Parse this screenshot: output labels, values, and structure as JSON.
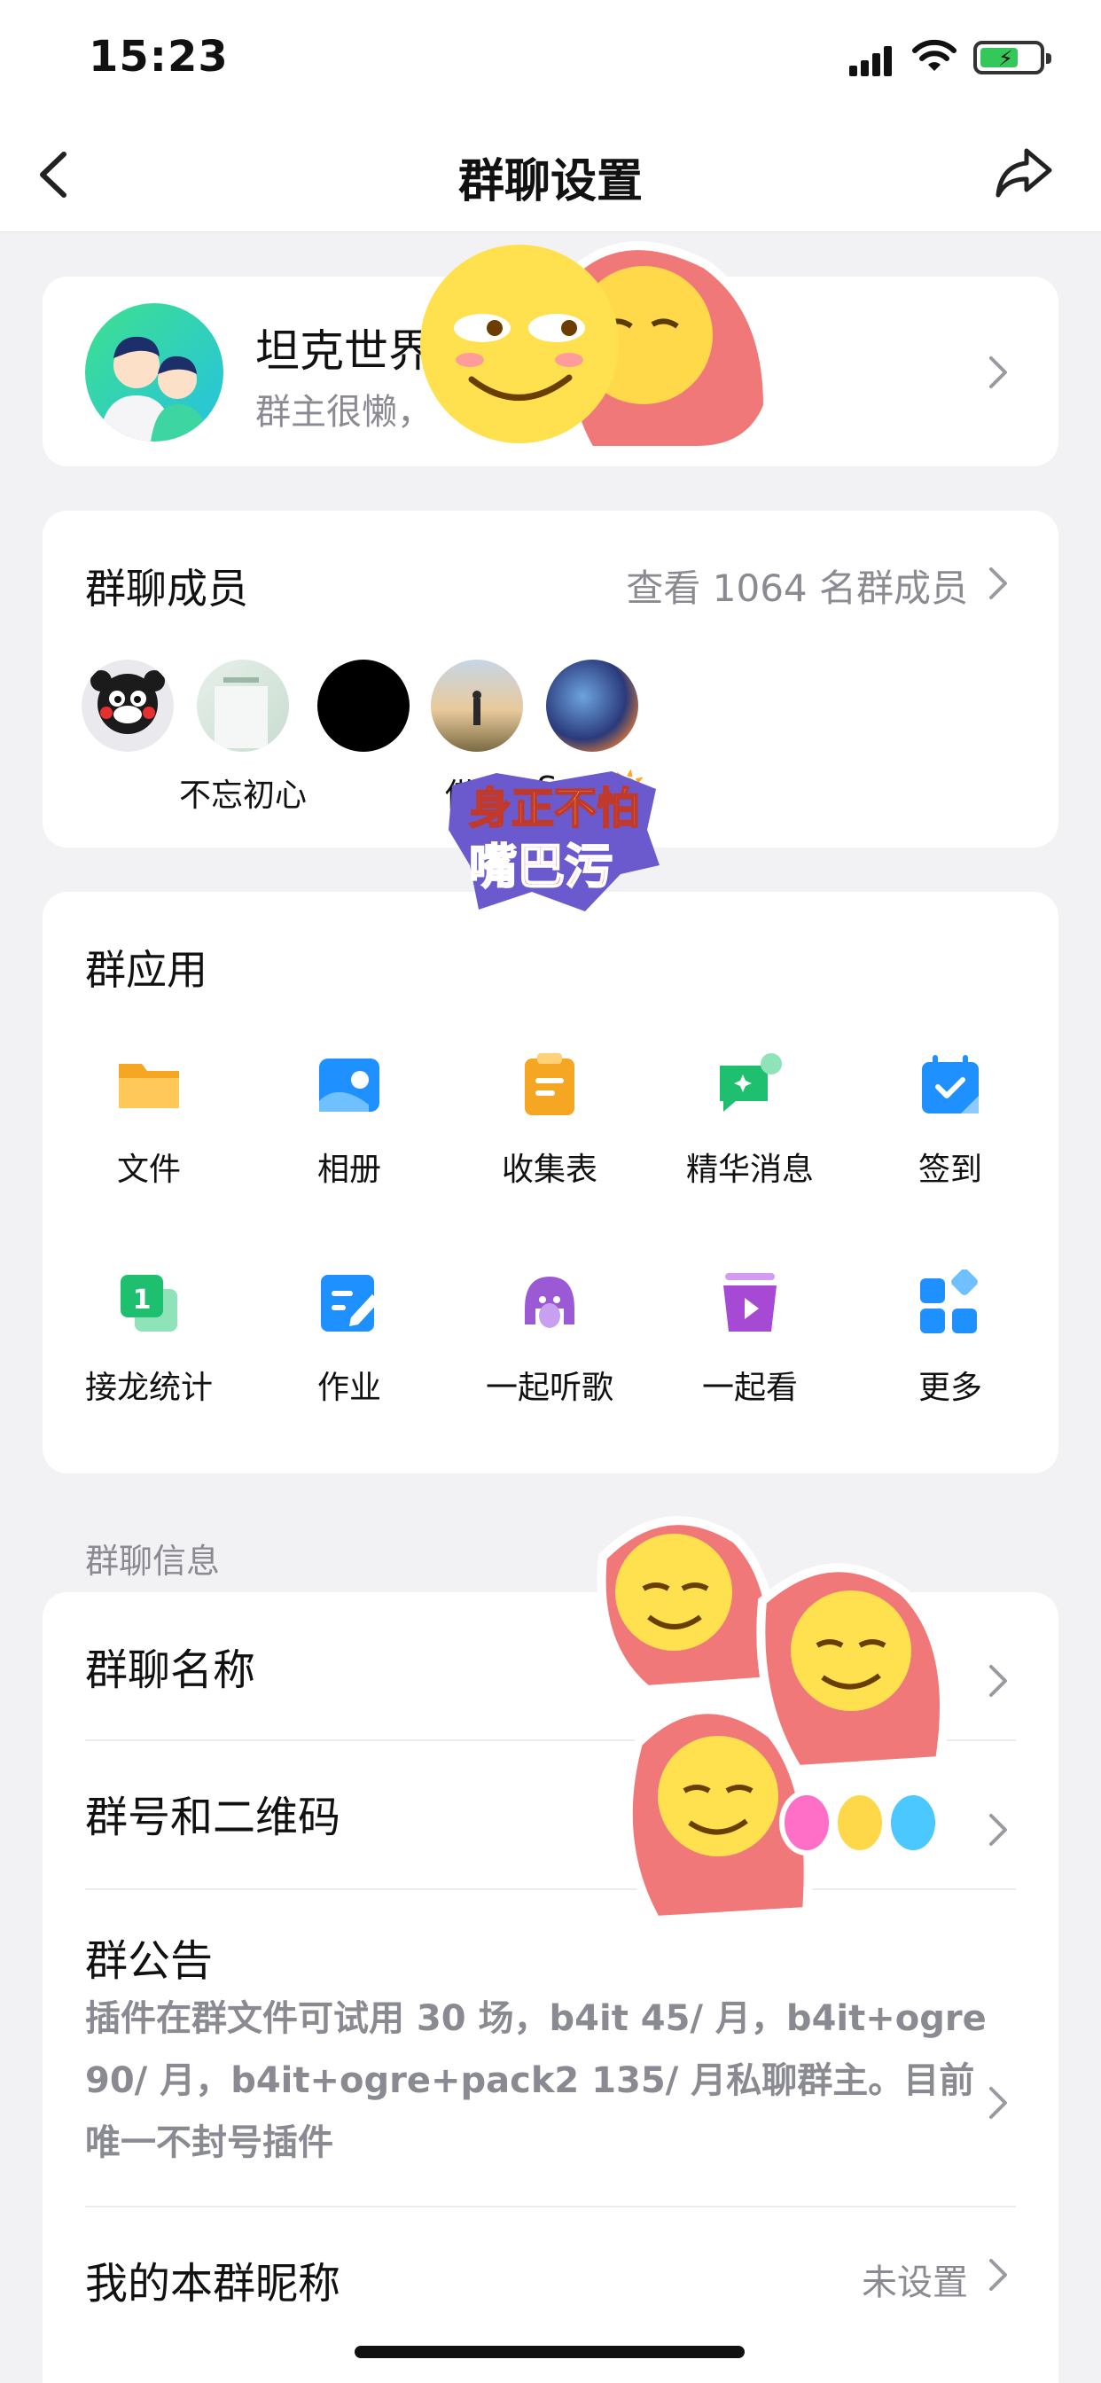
{
  "status_bar": {
    "time": "15:23"
  },
  "nav": {
    "title": "群聊设置"
  },
  "group": {
    "name": "坦克世界",
    "description": "群主很懒，"
  },
  "members": {
    "title": "群聊成员",
    "view_all": "查看 1064 名群成员",
    "list": [
      {
        "name": ""
      },
      {
        "name": "不忘初心"
      },
      {
        "name": ""
      },
      {
        "name": "借口"
      },
      {
        "name": "Sun.☀️"
      }
    ]
  },
  "apps": {
    "title": "群应用",
    "items": [
      {
        "label": "文件",
        "icon": "folder-icon",
        "color": "#f5a623"
      },
      {
        "label": "相册",
        "icon": "album-icon",
        "color": "#1e90ff"
      },
      {
        "label": "收集表",
        "icon": "form-icon",
        "color": "#f5a623"
      },
      {
        "label": "精华消息",
        "icon": "highlight-message-icon",
        "color": "#1fbf70"
      },
      {
        "label": "签到",
        "icon": "checkin-calendar-icon",
        "color": "#1e90ff"
      },
      {
        "label": "接龙统计",
        "icon": "relay-stats-icon",
        "color": "#1fbf70"
      },
      {
        "label": "作业",
        "icon": "homework-icon",
        "color": "#1e90ff"
      },
      {
        "label": "一起听歌",
        "icon": "listen-together-icon",
        "color": "#9b59d6"
      },
      {
        "label": "一起看",
        "icon": "watch-together-icon",
        "color": "#a64ad6"
      },
      {
        "label": "更多",
        "icon": "more-apps-icon",
        "color": "#1e90ff"
      }
    ]
  },
  "info": {
    "section_label": "群聊信息",
    "group_name_label": "群聊名称",
    "qr_label": "群号和二维码",
    "notice_label": "群公告",
    "notice_text": "插件在群文件可试用 30 场，b4it 45/ 月，b4it+ogre 90/ 月，b4it+ogre+pack2 135/ 月私聊群主。目前唯一不封号插件",
    "nickname_label": "我的本群昵称",
    "nickname_value": "未设置"
  },
  "stickers": {
    "text_top": "身正不怕",
    "text_bottom": "嘴巴污"
  }
}
